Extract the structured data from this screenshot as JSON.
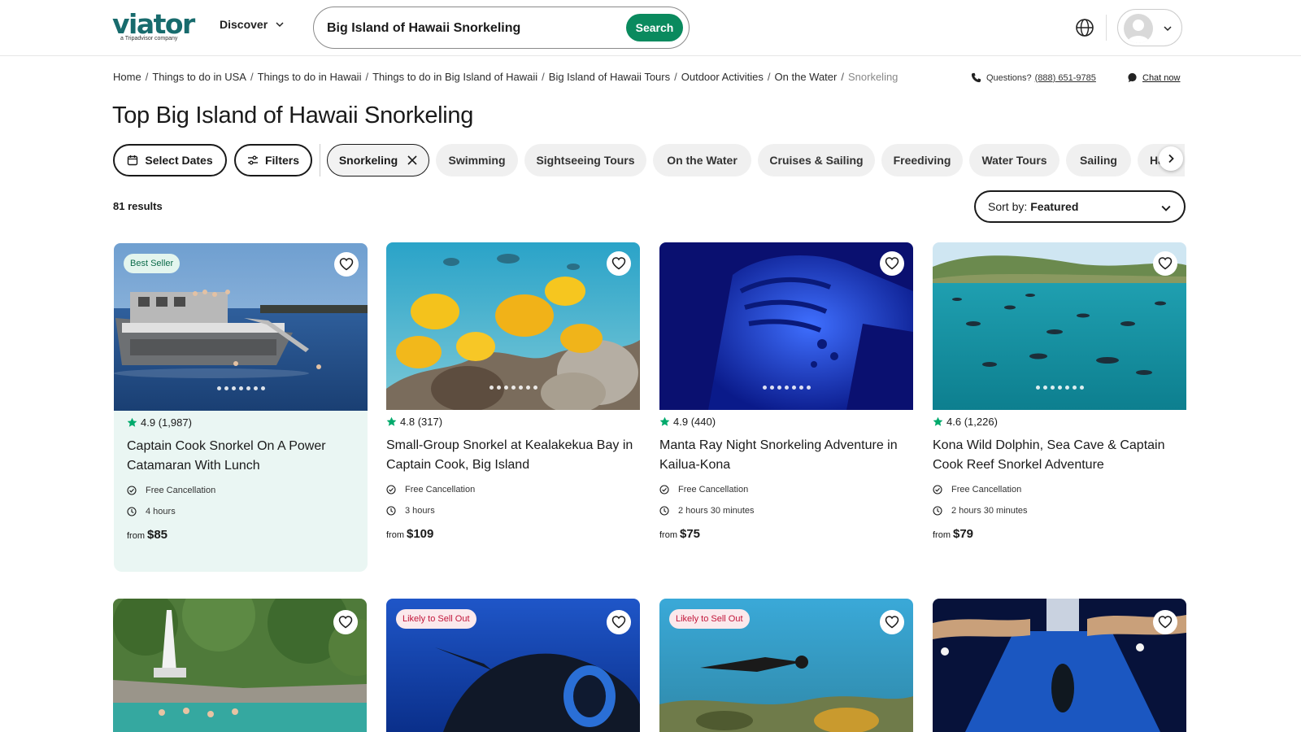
{
  "header": {
    "logo_text": "viator",
    "logo_sub": "a Tripadvisor company",
    "discover_label": "Discover",
    "search_value": "Big Island of Hawaii Snorkeling",
    "search_button": "Search"
  },
  "breadcrumb": {
    "items": [
      "Home",
      "Things to do in USA",
      "Things to do in Hawaii",
      "Things to do in Big Island of Hawaii",
      "Big Island of Hawaii Tours",
      "Outdoor Activities",
      "On the Water"
    ],
    "current": "Snorkeling",
    "separator": "/"
  },
  "contact": {
    "questions_label": "Questions?",
    "phone": "(888) 651-9785",
    "chat_label": "Chat now"
  },
  "page_title": "Top Big Island of Hawaii Snorkeling",
  "filters": {
    "select_dates": "Select Dates",
    "filters": "Filters",
    "selected_chip": "Snorkeling",
    "chips": [
      "Swimming",
      "Sightseeing Tours",
      "On the Water",
      "Cruises & Sailing",
      "Freediving",
      "Water Tours",
      "Sailing",
      "Ha"
    ]
  },
  "results_count": "81 results",
  "sort": {
    "label": "Sort by:",
    "value": "Featured"
  },
  "cards": [
    {
      "badge": "Best Seller",
      "rating": "4.9",
      "reviews": "(1,987)",
      "title": "Captain Cook Snorkel On A Power Catamaran With Lunch",
      "cancellation": "Free Cancellation",
      "duration": "4 hours",
      "price_prefix": "from",
      "price": "$85"
    },
    {
      "badge": "",
      "rating": "4.8",
      "reviews": "(317)",
      "title": "Small-Group Snorkel at Kealakekua Bay in Captain Cook, Big Island",
      "cancellation": "Free Cancellation",
      "duration": "3 hours",
      "price_prefix": "from",
      "price": "$109"
    },
    {
      "badge": "",
      "rating": "4.9",
      "reviews": "(440)",
      "title": "Manta Ray Night Snorkeling Adventure in Kailua-Kona",
      "cancellation": "Free Cancellation",
      "duration": "2 hours 30 minutes",
      "price_prefix": "from",
      "price": "$75"
    },
    {
      "badge": "",
      "rating": "4.6",
      "reviews": "(1,226)",
      "title": "Kona Wild Dolphin, Sea Cave & Captain Cook Reef Snorkel Adventure",
      "cancellation": "Free Cancellation",
      "duration": "2 hours 30 minutes",
      "price_prefix": "from",
      "price": "$79"
    }
  ],
  "row2_badges": [
    "",
    "Likely to Sell Out",
    "Likely to Sell Out",
    ""
  ],
  "colors": {
    "brand": "#186b6d",
    "search_button": "#0a8a5e",
    "rating_star": "#00aa6c",
    "best_seller_bg": "#e3f5ee",
    "sell_out_text": "#c2163a",
    "highlight_card_bg": "#eaf6f3"
  },
  "icons": {
    "discover": "chevron-down-icon",
    "language": "globe-icon",
    "profile": "user-avatar-icon",
    "phone": "phone-icon",
    "chat": "chat-bubble-icon",
    "dates": "calendar-icon",
    "filters": "sliders-icon",
    "remove_chip": "close-icon",
    "scroll_chips": "chevron-right-icon",
    "wishlist": "heart-icon",
    "rating": "star-icon",
    "cancellation": "check-circle-icon",
    "duration": "clock-icon"
  }
}
